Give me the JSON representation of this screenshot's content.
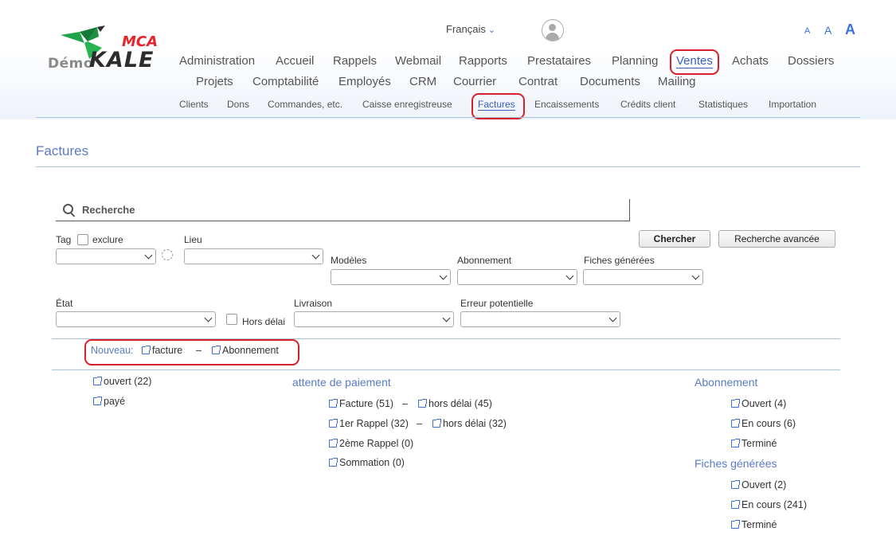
{
  "logo": {
    "demo": "Démo",
    "brand": "KALE",
    "badge": "MCA"
  },
  "header": {
    "language": "Français",
    "font_sizes": [
      "A",
      "A",
      "A"
    ]
  },
  "nav_main": [
    "Administration",
    "Accueil",
    "Rappels",
    "Webmail",
    "Rapports",
    "Prestataires",
    "Planning",
    "Ventes",
    "Achats",
    "Dossiers"
  ],
  "nav_main2": [
    "Projets",
    "Comptabilité",
    "Employés",
    "CRM",
    "Courrier",
    "Contrat",
    "Documents",
    "Mailing"
  ],
  "nav_sub": [
    "Clients",
    "Dons",
    "Commandes, etc.",
    "Caisse enregistreuse",
    "Factures",
    "Encaissements",
    "Crédits client",
    "Statistiques",
    "Importation"
  ],
  "page": {
    "title": "Factures"
  },
  "search": {
    "placeholder": "Recherche"
  },
  "filters": {
    "tag": "Tag",
    "exclude": "exclure",
    "lieu": "Lieu",
    "modeles": "Modèles",
    "abonnement": "Abonnement",
    "fiches": "Fiches générées",
    "etat": "État",
    "hors_delai": "Hors délai",
    "livraison": "Livraison",
    "erreur": "Erreur potentielle"
  },
  "buttons": {
    "search": "Chercher",
    "advanced": "Recherche avancée"
  },
  "new_bar": {
    "label": "Nouveau:",
    "facture": "facture",
    "dash": "–",
    "abonnement": "Abonnement"
  },
  "col1": {
    "ouvert": "ouvert (22)",
    "paye": "payé"
  },
  "col2": {
    "title": "attente de paiement",
    "facture": "Facture (51)",
    "facture_hd": "hors délai (45)",
    "rappel1": "1er Rappel (32)",
    "rappel1_hd": "hors délai (32)",
    "rappel2": "2ème Rappel (0)",
    "sommation": "Sommation (0)",
    "dash": "–"
  },
  "col3": {
    "abo_title": "Abonnement",
    "abo_ouvert": "Ouvert (4)",
    "abo_encours": "En cours (6)",
    "abo_termine": "Terminé",
    "fiches_title": "Fiches générées",
    "fiches_ouvert": "Ouvert (2)",
    "fiches_encours": "En cours (241)",
    "fiches_termine": "Terminé"
  },
  "colors": {
    "accent": "#5b7bc4",
    "highlight": "#d8202a",
    "logo_green": "#1fa24a"
  }
}
